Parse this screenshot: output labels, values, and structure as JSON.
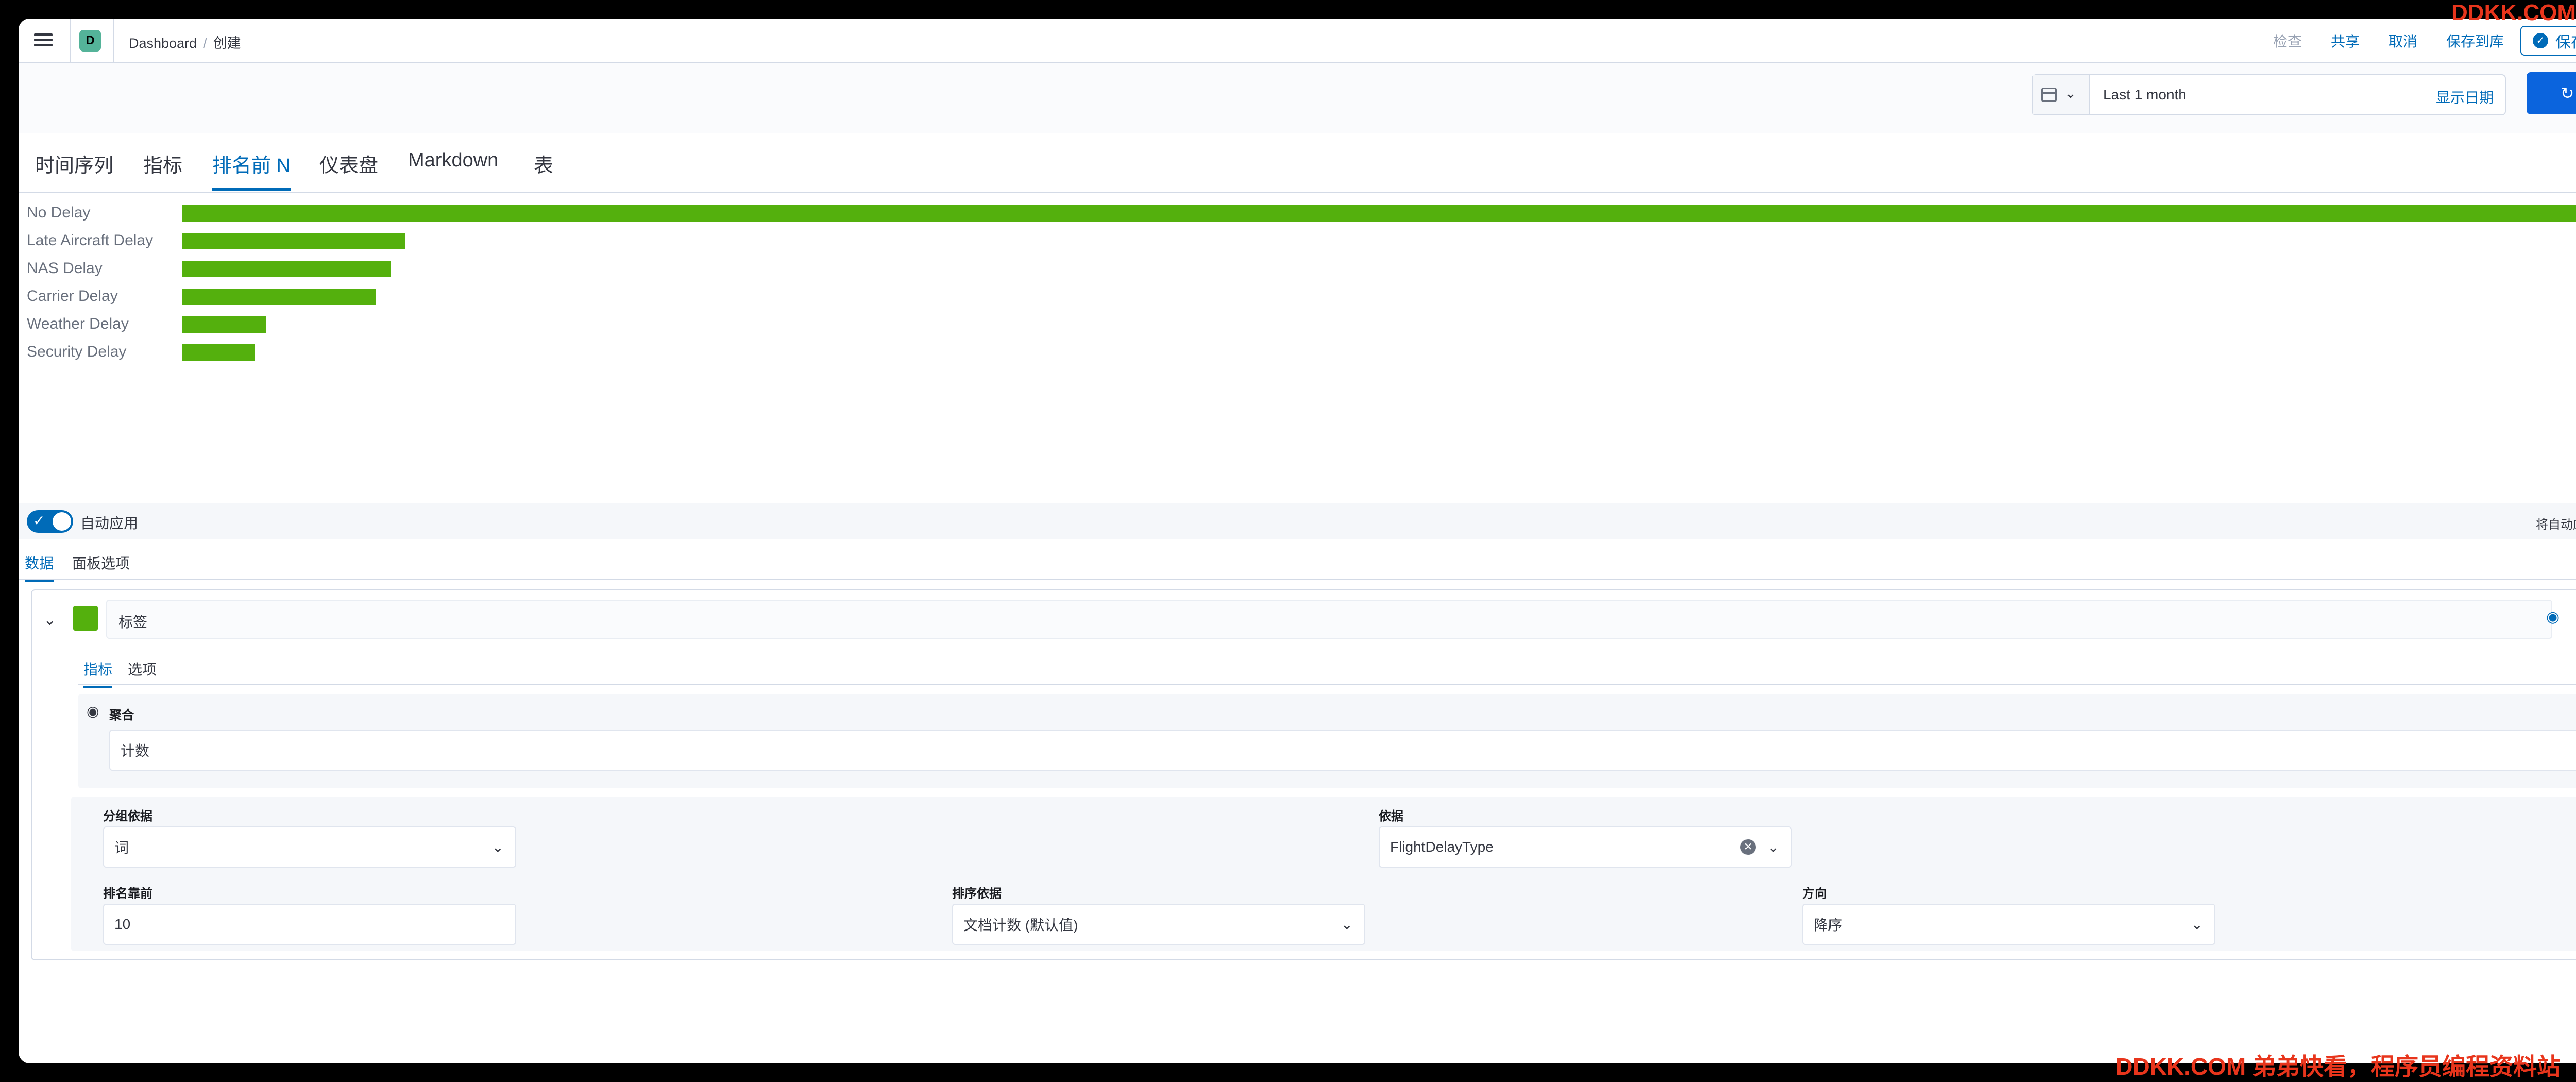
{
  "header": {
    "space_initial": "D",
    "breadcrumb": [
      "Dashboard",
      "创建"
    ],
    "links": {
      "inspect": "检查",
      "share": "共享",
      "cancel": "取消",
      "save_to_library": "保存到库"
    },
    "save_and_return": "保存并返回"
  },
  "querybar": {
    "time_range": "Last 1 month",
    "show_dates": "显示日期",
    "refresh": "刷新"
  },
  "vis_tabs": [
    "时间序列",
    "指标",
    "排名前 N",
    "仪表盘",
    "Markdown",
    "表"
  ],
  "vis_tab_active": "排名前 N",
  "chart_data": {
    "type": "bar",
    "orientation": "horizontal",
    "categories": [
      "No Delay",
      "Late Aircraft Delay",
      "NAS Delay",
      "Carrier Delay",
      "Weather Delay",
      "Security Delay"
    ],
    "values": [
      2552,
      237,
      222,
      206,
      89,
      77
    ],
    "value_labels": [
      "2,552",
      "237",
      "222",
      "206",
      "89",
      "77"
    ],
    "color": "#54b00d"
  },
  "auto_apply": {
    "label": "自动应用",
    "note": "将自动应用更改。",
    "enabled": true
  },
  "editor_tabs": [
    "数据",
    "面板选项"
  ],
  "series": {
    "label_placeholder": "标签",
    "color": "#54b00d",
    "inner_tabs": [
      "指标",
      "选项"
    ],
    "metric": {
      "label": "聚合",
      "value": "计数"
    },
    "group_by": {
      "label": "分组依据",
      "value": "词"
    },
    "by": {
      "label": "依据",
      "value": "FlightDelayType"
    },
    "top_n": {
      "label": "排名靠前",
      "value": "10"
    },
    "order_by": {
      "label": "排序依据",
      "value": "文档计数 (默认值)"
    },
    "direction": {
      "label": "方向",
      "value": "降序"
    }
  },
  "watermark": {
    "top": "DDKK.COM",
    "bottom": "DDKK.COM 弟弟快看，程序员编程资料站"
  }
}
